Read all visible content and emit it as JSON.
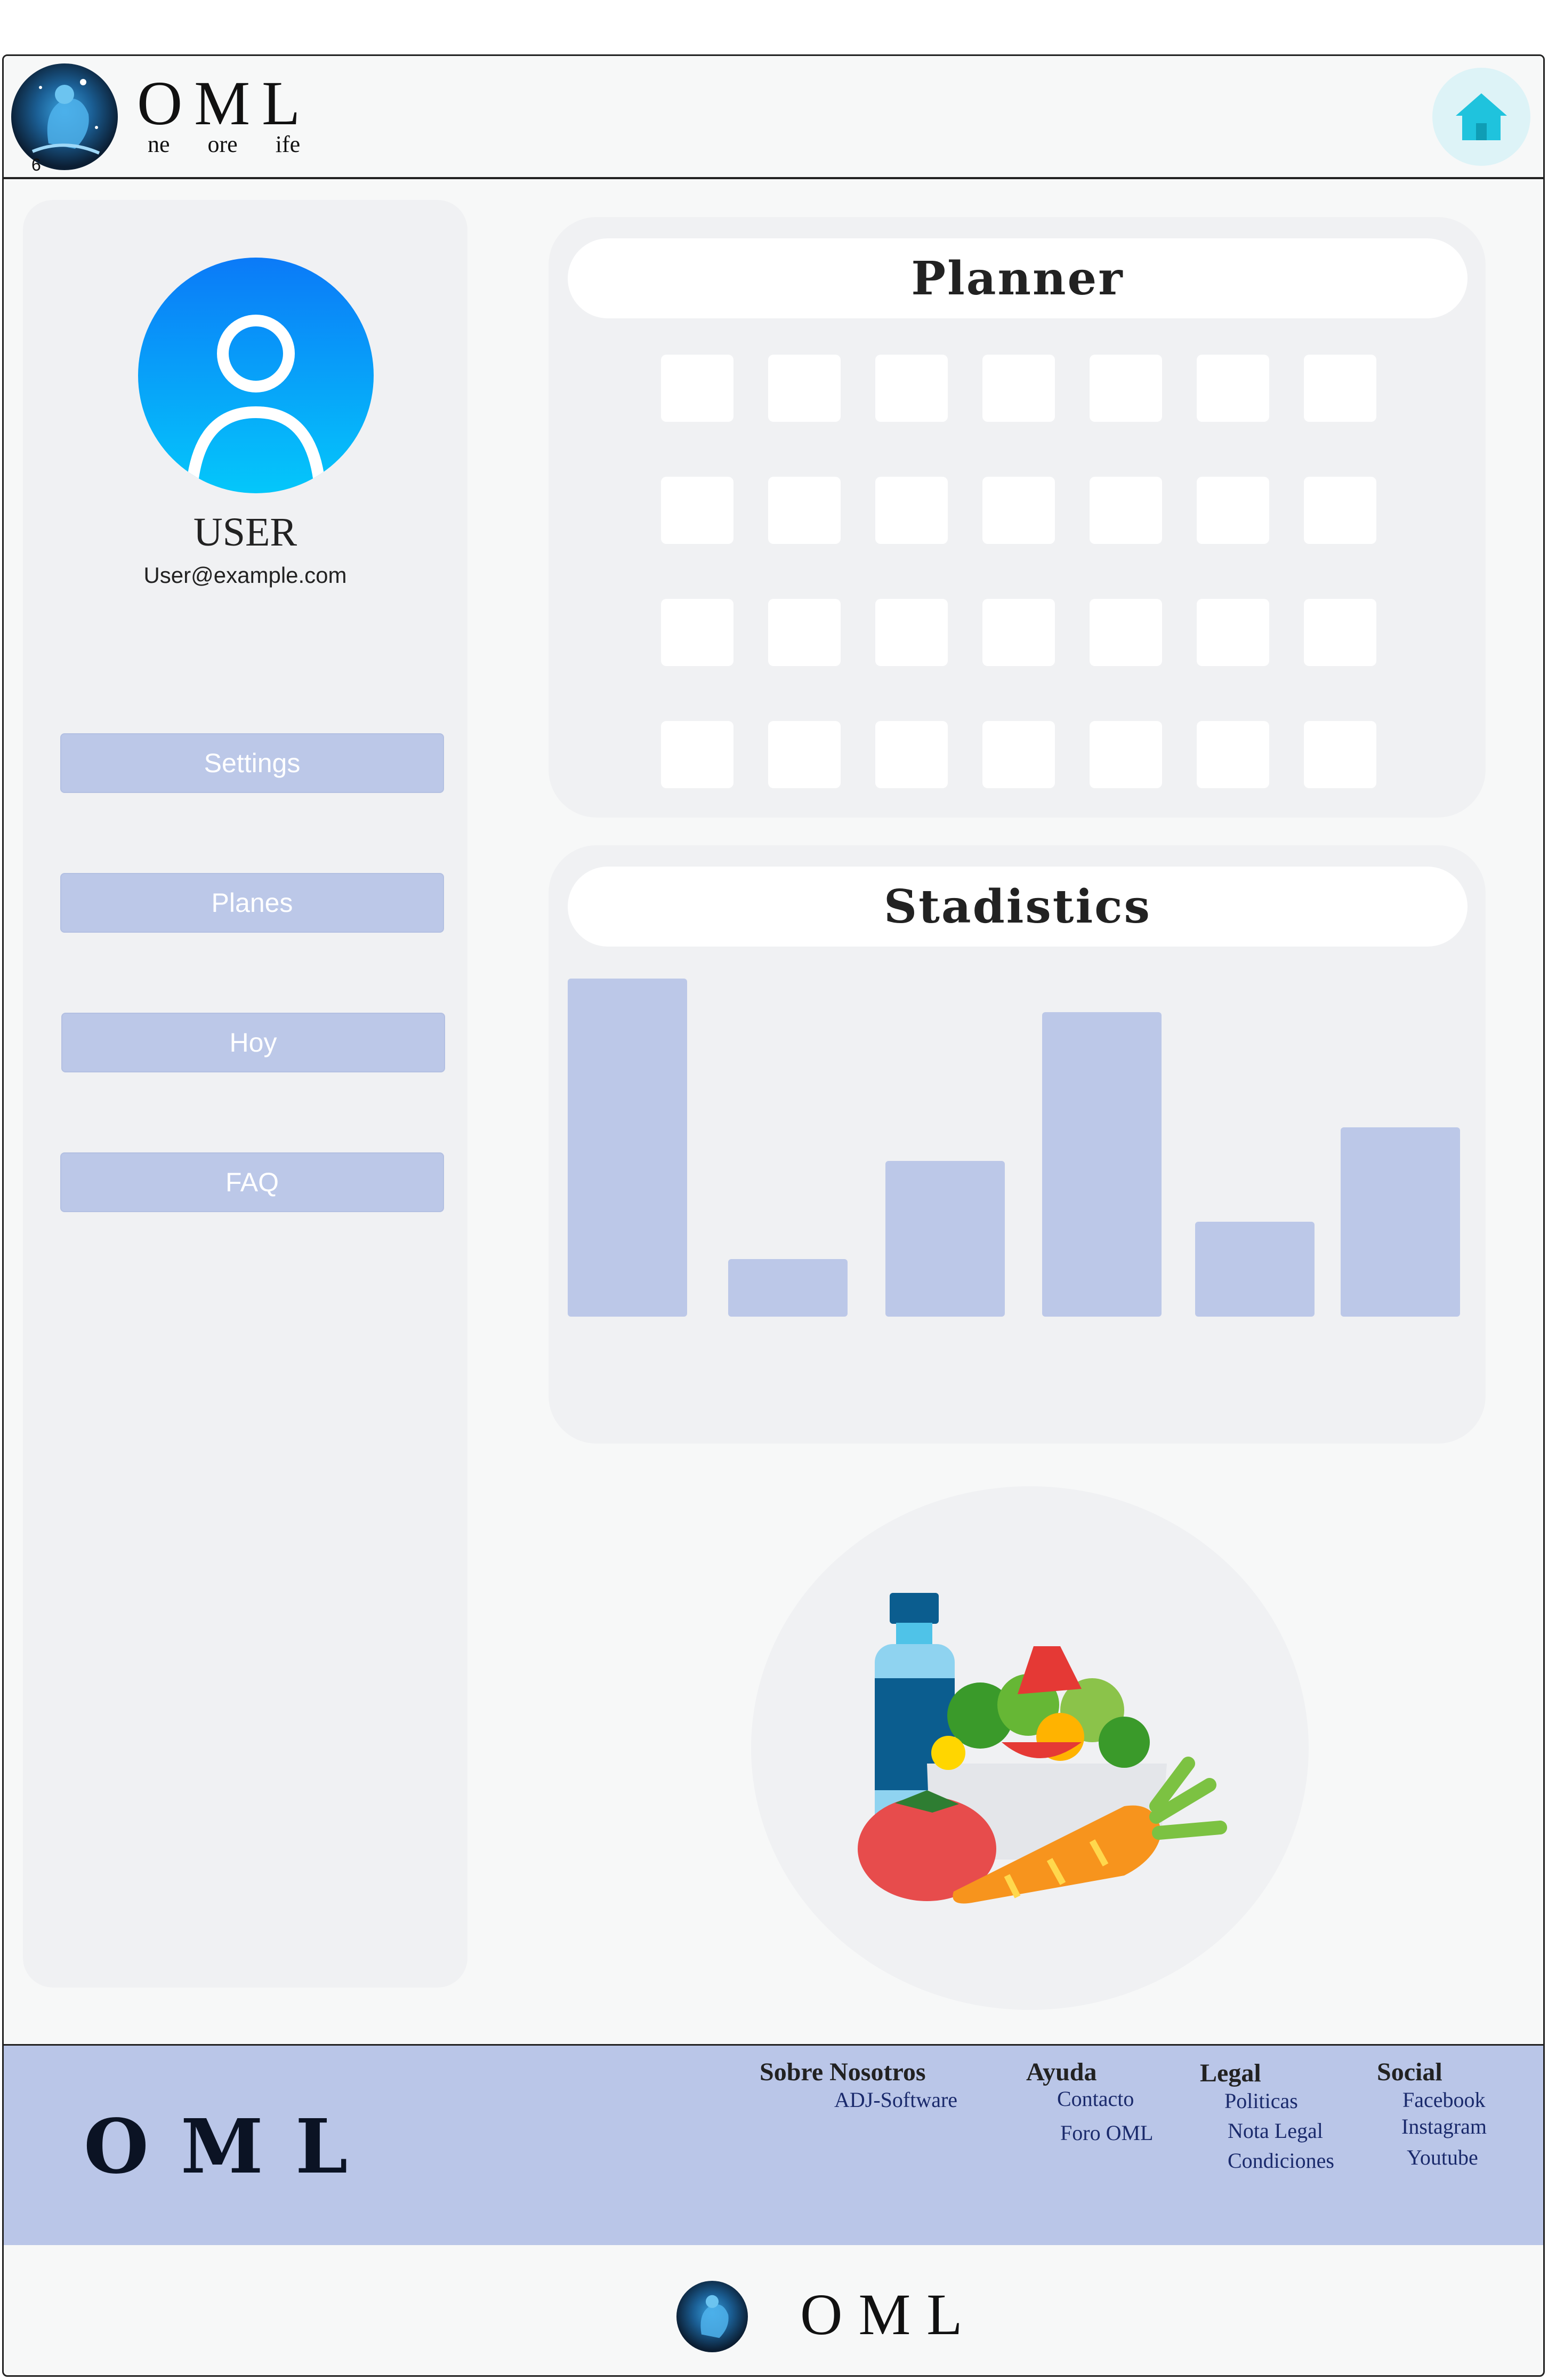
{
  "header": {
    "brand": "OML",
    "tagline": "ne ore ife",
    "logo_badge": "6",
    "home_icon": "home-icon"
  },
  "sidebar": {
    "user_name": "USER",
    "user_email": "User@example.com",
    "avatar_icon": "user-avatar-icon",
    "buttons": [
      {
        "label": "Settings"
      },
      {
        "label": "Planes"
      },
      {
        "label": "Hoy"
      },
      {
        "label": "FAQ"
      }
    ]
  },
  "planner": {
    "title": "Planner",
    "rows": 4,
    "cols": 7
  },
  "statistics": {
    "title": "Stadistics"
  },
  "chart_data": {
    "type": "bar",
    "values": [
      100,
      17,
      46,
      90,
      28,
      56
    ],
    "bar_color": "#bcc8e8"
  },
  "illustration": {
    "icon": "healthy-food-icon"
  },
  "footer": {
    "brand": "OML",
    "columns": [
      {
        "title": "Sobre Nosotros",
        "links": [
          "ADJ-Software"
        ]
      },
      {
        "title": "Ayuda",
        "links": [
          "Contacto",
          "Foro OML"
        ]
      },
      {
        "title": "Legal",
        "links": [
          "Politicas",
          "Nota Legal",
          "Condiciones"
        ]
      },
      {
        "title": "Social",
        "links": [
          "Facebook",
          "Instagram",
          "Youtube"
        ]
      }
    ],
    "bottom_brand": "OML"
  },
  "colors": {
    "accent": "#bcc8e8",
    "avatar_top": "#0b7af8",
    "avatar_bottom": "#04c7fa",
    "home_icon": "#1fc3dd"
  }
}
